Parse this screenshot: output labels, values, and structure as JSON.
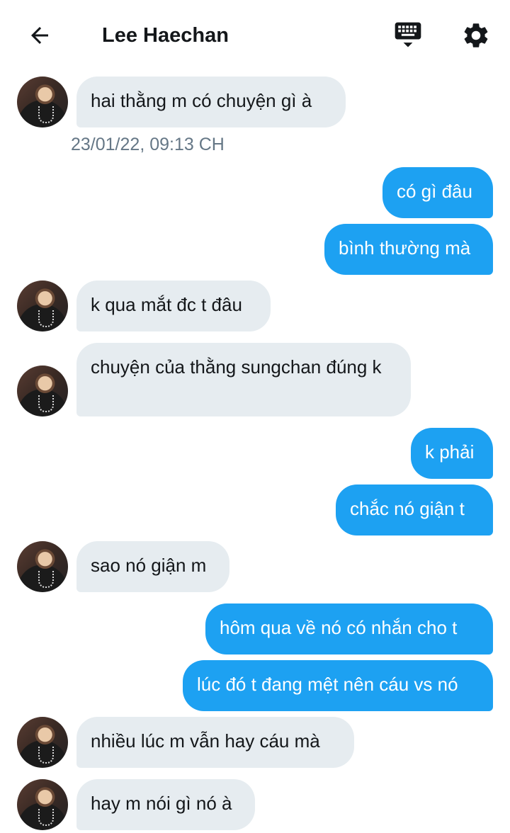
{
  "header": {
    "title": "Lee Haechan",
    "back_icon": "arrow-left-icon",
    "keyboard_icon": "keyboard-icon",
    "settings_icon": "gear-icon"
  },
  "colors": {
    "incoming_bubble": "#e6ecf0",
    "outgoing_bubble": "#1da1f2",
    "timestamp": "#657786"
  },
  "messages": [
    {
      "side": "in",
      "text": "hai thằng m có chuyện gì à"
    },
    {
      "side": "meta",
      "text": "23/01/22, 09:13 CH"
    },
    {
      "side": "out",
      "text": "có gì đâu"
    },
    {
      "side": "out",
      "text": "bình thường mà"
    },
    {
      "side": "in",
      "text": "k qua mắt đc t đâu"
    },
    {
      "side": "in",
      "text": "chuyện của thằng sungchan đúng k"
    },
    {
      "side": "out",
      "text": "k phải"
    },
    {
      "side": "out",
      "text": "chắc nó giận t"
    },
    {
      "side": "in",
      "text": "sao nó giận m"
    },
    {
      "side": "out",
      "text": "hôm qua về nó có nhắn cho t"
    },
    {
      "side": "out",
      "text": "lúc đó t đang mệt nên cáu vs nó"
    },
    {
      "side": "in",
      "text": "nhiều lúc m vẫn hay cáu mà"
    },
    {
      "side": "in",
      "text": "hay m nói gì nó à"
    }
  ]
}
